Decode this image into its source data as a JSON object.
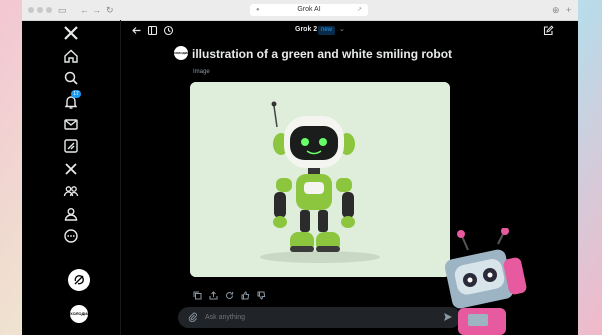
{
  "browser": {
    "url_text": "Grok AI",
    "back_arrow": "←",
    "forward_arrow": "→",
    "reload": "↻",
    "download": "⊕",
    "new_tab": "+",
    "lock": "🔒",
    "share": "⤴"
  },
  "sidebar": {
    "notification_count": "17",
    "avatar_text": "ХОЛОДИЛЬНИК"
  },
  "topbar": {
    "model_name": "Grok 2",
    "new_badge": "new",
    "chevron": "⌄"
  },
  "conversation": {
    "user_avatar_text": "ХОЛОДИЛЬНИК",
    "prompt": "illustration of a green and white smiling robot",
    "result_label": "Image"
  },
  "composer": {
    "placeholder": "Ask anything"
  },
  "colors": {
    "accent": "#1d9bf0",
    "background": "#000000",
    "robot_green": "#8cc63f"
  },
  "icons": [
    "x-logo",
    "home-icon",
    "search-icon",
    "bell-icon",
    "mail-icon",
    "grok-icon",
    "x-icon",
    "people-icon",
    "profile-icon",
    "more-icon",
    "grok-compose-icon",
    "back-icon",
    "sidebar-icon",
    "history-icon",
    "new-chat-icon",
    "copy-icon",
    "share-icon",
    "regenerate-icon",
    "thumbs-up-icon",
    "thumbs-down-icon",
    "attach-icon",
    "send-icon"
  ]
}
